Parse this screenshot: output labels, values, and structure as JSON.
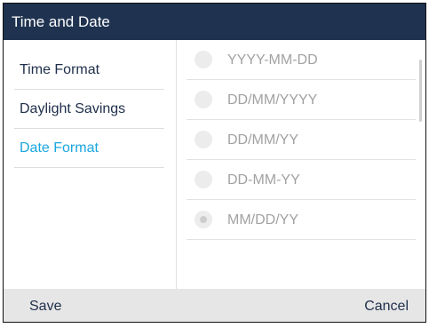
{
  "window": {
    "title": "Time and Date"
  },
  "sidebar": {
    "items": [
      {
        "label": "Time Format",
        "active": false
      },
      {
        "label": "Daylight Savings",
        "active": false
      },
      {
        "label": "Date Format",
        "active": true
      }
    ]
  },
  "date_format": {
    "options": [
      {
        "label": "YYYY-MM-DD",
        "selected": false
      },
      {
        "label": "DD/MM/YYYY",
        "selected": false
      },
      {
        "label": "DD/MM/YY",
        "selected": false
      },
      {
        "label": "DD-MM-YY",
        "selected": false
      },
      {
        "label": "MM/DD/YY",
        "selected": true
      }
    ]
  },
  "softkeys": {
    "save": "Save",
    "cancel": "Cancel"
  },
  "colors": {
    "titlebar": "#1f3350",
    "active_item": "#1aa6de",
    "item_text": "#1f2f4a",
    "option_text": "#a2a2a2",
    "softkey_bar": "#e6e6e6"
  }
}
